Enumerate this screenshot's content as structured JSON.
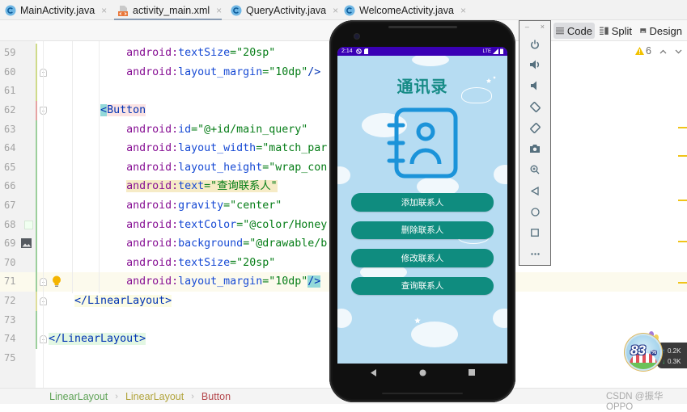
{
  "tabs": [
    {
      "label": "MainActivity.java",
      "icon": "java-class-icon",
      "active": false
    },
    {
      "label": "activity_main.xml",
      "icon": "xml-layout-icon",
      "active": true
    },
    {
      "label": "QueryActivity.java",
      "icon": "java-class-icon",
      "active": false
    },
    {
      "label": "WelcomeActivity.java",
      "icon": "java-class-icon",
      "active": false
    }
  ],
  "tab_close_glyph": "×",
  "view_modes": [
    {
      "label": "Code",
      "icon": "code-view-icon",
      "active": true
    },
    {
      "label": "Split",
      "icon": "split-view-icon",
      "active": false
    },
    {
      "label": "Design",
      "icon": "design-view-icon",
      "active": false
    }
  ],
  "inspections": {
    "icon": "warning-icon",
    "warning_count": "6",
    "prev_glyph": "⌃",
    "next_glyph": "⌄"
  },
  "code": {
    "lines": [
      {
        "number": "59",
        "vcs": "#cfdb8a",
        "tokens": [
          {
            "k": "ws",
            "v": "            "
          },
          {
            "k": "ns",
            "v": "android:"
          },
          {
            "k": "attr",
            "v": "textSize"
          },
          {
            "k": "value",
            "v": "=\"20sp\""
          }
        ]
      },
      {
        "number": "60",
        "vcs": "#cfdb8a",
        "fold": "end",
        "tokens": [
          {
            "k": "ws",
            "v": "            "
          },
          {
            "k": "ns",
            "v": "android:"
          },
          {
            "k": "attr",
            "v": "layout_margin"
          },
          {
            "k": "value",
            "v": "=\"10dp\""
          },
          {
            "k": "bracket",
            "v": "/>"
          }
        ]
      },
      {
        "number": "61",
        "vcs": "#cfdb8a",
        "tokens": []
      },
      {
        "number": "62",
        "vcs": "#e6a3a3",
        "fold": "start",
        "tokens": [
          {
            "k": "ws",
            "v": "        "
          },
          {
            "k": "bracket",
            "v": "<",
            "hl": "brace-match"
          },
          {
            "k": "tag",
            "v": "Button",
            "hl": "tag-match"
          }
        ]
      },
      {
        "number": "63",
        "vcs": "#9ccf9c",
        "tokens": [
          {
            "k": "ws",
            "v": "            "
          },
          {
            "k": "ns",
            "v": "android:"
          },
          {
            "k": "attr",
            "v": "id"
          },
          {
            "k": "value",
            "v": "=\"@+id/main_query\""
          }
        ]
      },
      {
        "number": "64",
        "vcs": "#9ccf9c",
        "tokens": [
          {
            "k": "ws",
            "v": "            "
          },
          {
            "k": "ns",
            "v": "android:"
          },
          {
            "k": "attr",
            "v": "layout_width"
          },
          {
            "k": "value",
            "v": "=\"match_par"
          }
        ]
      },
      {
        "number": "65",
        "vcs": "#9ccf9c",
        "tokens": [
          {
            "k": "ws",
            "v": "            "
          },
          {
            "k": "ns",
            "v": "android:"
          },
          {
            "k": "attr",
            "v": "layout_height"
          },
          {
            "k": "value",
            "v": "=\"wrap_con"
          }
        ]
      },
      {
        "number": "66",
        "vcs": "#9ccf9c",
        "tokens": [
          {
            "k": "ws",
            "v": "            "
          },
          {
            "k": "ns",
            "v": "android:",
            "hl": "usage"
          },
          {
            "k": "attr",
            "v": "text",
            "hl": "usage"
          },
          {
            "k": "value",
            "v": "=\"查询联系人\"",
            "hl": "usage"
          }
        ]
      },
      {
        "number": "67",
        "vcs": "#9ccf9c",
        "tokens": [
          {
            "k": "ws",
            "v": "            "
          },
          {
            "k": "ns",
            "v": "android:"
          },
          {
            "k": "attr",
            "v": "gravity"
          },
          {
            "k": "value",
            "v": "=\"center\""
          }
        ]
      },
      {
        "number": "68",
        "vcs": "#9ccf9c",
        "gutter_swatch": "#f0fff0",
        "tokens": [
          {
            "k": "ws",
            "v": "            "
          },
          {
            "k": "ns",
            "v": "android:"
          },
          {
            "k": "attr",
            "v": "textColor"
          },
          {
            "k": "value",
            "v": "=\"@color/Honey"
          }
        ]
      },
      {
        "number": "69",
        "vcs": "#9ccf9c",
        "gutter_icon": "image-icon",
        "tokens": [
          {
            "k": "ws",
            "v": "            "
          },
          {
            "k": "ns",
            "v": "android:"
          },
          {
            "k": "attr",
            "v": "background"
          },
          {
            "k": "value",
            "v": "=\"@drawable/b"
          }
        ]
      },
      {
        "number": "70",
        "vcs": "#9ccf9c",
        "tokens": [
          {
            "k": "ws",
            "v": "            "
          },
          {
            "k": "ns",
            "v": "android:"
          },
          {
            "k": "attr",
            "v": "textSize"
          },
          {
            "k": "value",
            "v": "=\"20sp\""
          }
        ]
      },
      {
        "number": "71",
        "vcs": "#9ccf9c",
        "fold": "end",
        "current": true,
        "intention": "lightbulb-icon",
        "tokens": [
          {
            "k": "ws",
            "v": "            "
          },
          {
            "k": "ns",
            "v": "android:"
          },
          {
            "k": "attr",
            "v": "layout_margin"
          },
          {
            "k": "value",
            "v": "=\"10dp\""
          },
          {
            "k": "bracket",
            "v": "/>",
            "hl": "brace-match"
          }
        ]
      },
      {
        "number": "72",
        "vcs": "#dede9a",
        "fold": "end",
        "tokens": [
          {
            "k": "ws",
            "v": "    "
          },
          {
            "k": "bracket",
            "v": "</",
            "hl": "scope"
          },
          {
            "k": "tag",
            "v": "LinearLayout",
            "hl": "scope"
          },
          {
            "k": "bracket",
            "v": ">",
            "hl": "scope"
          }
        ]
      },
      {
        "number": "73",
        "vcs": "#9ccf9c",
        "tokens": []
      },
      {
        "number": "74",
        "vcs": "#9ccf9c",
        "fold": "end",
        "tokens": [
          {
            "k": "bracket",
            "v": "</",
            "hl": "added"
          },
          {
            "k": "tag",
            "v": "LinearLayout",
            "hl": "added"
          },
          {
            "k": "bracket",
            "v": ">",
            "hl": "added"
          }
        ]
      },
      {
        "number": "75",
        "tokens": []
      }
    ]
  },
  "breadcrumb": [
    {
      "label": "LinearLayout",
      "color": "#5fa357"
    },
    {
      "label": "LinearLayout",
      "color": "#b1a43c"
    },
    {
      "label": "Button",
      "color": "#b4464b"
    }
  ],
  "breadcrumb_separator": "›",
  "emulator": {
    "status_bar": {
      "time": "2:14",
      "network": "LTE"
    },
    "app": {
      "title": "通讯录",
      "buttons": [
        {
          "label": "添加联系人"
        },
        {
          "label": "删除联系人"
        },
        {
          "label": "修改联系人"
        },
        {
          "label": "查询联系人"
        }
      ]
    }
  },
  "emulator_panel": {
    "header": {
      "minimize_glyph": "–",
      "close_glyph": "×"
    },
    "controls": [
      "power-icon",
      "volume-up-icon",
      "volume-down-icon",
      "rotate-left-icon",
      "rotate-right-icon",
      "screenshot-icon",
      "zoom-icon",
      "back-icon",
      "home-icon",
      "overview-icon",
      "more-icon"
    ]
  },
  "overlay": {
    "score": "83",
    "score_unit": "%",
    "upload_arrow": "↑",
    "upload": "0.2K",
    "download_arrow": "↓",
    "download": "0.3K"
  },
  "watermark": "CSDN @振华OPPO"
}
